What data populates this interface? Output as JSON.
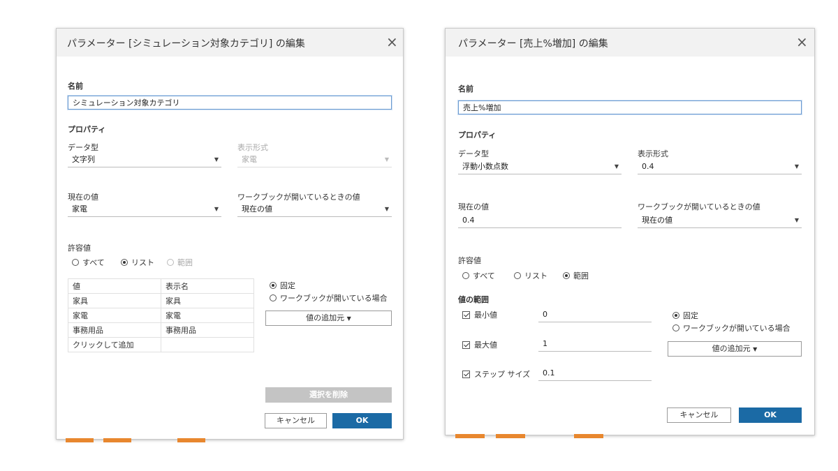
{
  "dialog1": {
    "title": "パラメーター [シミュレーション対象カテゴリ] の編集",
    "name_label": "名前",
    "name_value": "シミュレーション対象カテゴリ",
    "properties_label": "プロパティ",
    "data_type_label": "データ型",
    "data_type_value": "文字列",
    "display_format_label": "表示形式",
    "display_format_value": "家電",
    "current_value_label": "現在の値",
    "current_value": "家電",
    "workbook_open_label": "ワークブックが開いているときの値",
    "workbook_open_value": "現在の値",
    "allowed_values_label": "許容値",
    "allowed_options": [
      "すべて",
      "リスト",
      "範囲"
    ],
    "table": {
      "headers": [
        "値",
        "表示名"
      ],
      "rows": [
        [
          "家具",
          "家具"
        ],
        [
          "家電",
          "家電"
        ],
        [
          "事務用品",
          "事務用品"
        ]
      ],
      "add_row_text": "クリックして追加"
    },
    "fixed_label": "固定",
    "workbook_open_case_label": "ワークブックが開いている場合",
    "add_values_from_label": "値の追加元",
    "remove_selection_label": "選択を削除",
    "cancel_label": "キャンセル",
    "ok_label": "OK"
  },
  "dialog2": {
    "title": "パラメーター [売上%増加] の編集",
    "name_label": "名前",
    "name_value": "売上%増加",
    "properties_label": "プロパティ",
    "data_type_label": "データ型",
    "data_type_value": "浮動小数点数",
    "display_format_label": "表示形式",
    "display_format_value": "0.4",
    "current_value_label": "現在の値",
    "current_value": "0.4",
    "workbook_open_label": "ワークブックが開いているときの値",
    "workbook_open_value": "現在の値",
    "allowed_values_label": "許容値",
    "allowed_options": [
      "すべて",
      "リスト",
      "範囲"
    ],
    "range_label": "値の範囲",
    "min_label": "最小値",
    "min_value": "0",
    "max_label": "最大値",
    "max_value": "1",
    "step_label": "ステップ サイズ",
    "step_value": "0.1",
    "fixed_label": "固定",
    "workbook_open_case_label": "ワークブックが開いている場合",
    "add_values_from_label": "値の追加元",
    "cancel_label": "キャンセル",
    "ok_label": "OK"
  },
  "icons": {
    "close": "×",
    "dropdown": "▼"
  },
  "colors": {
    "primary_button": "#1b6aa5",
    "focus_border": "#6b9bd1",
    "background_bar": "#e8872e"
  }
}
